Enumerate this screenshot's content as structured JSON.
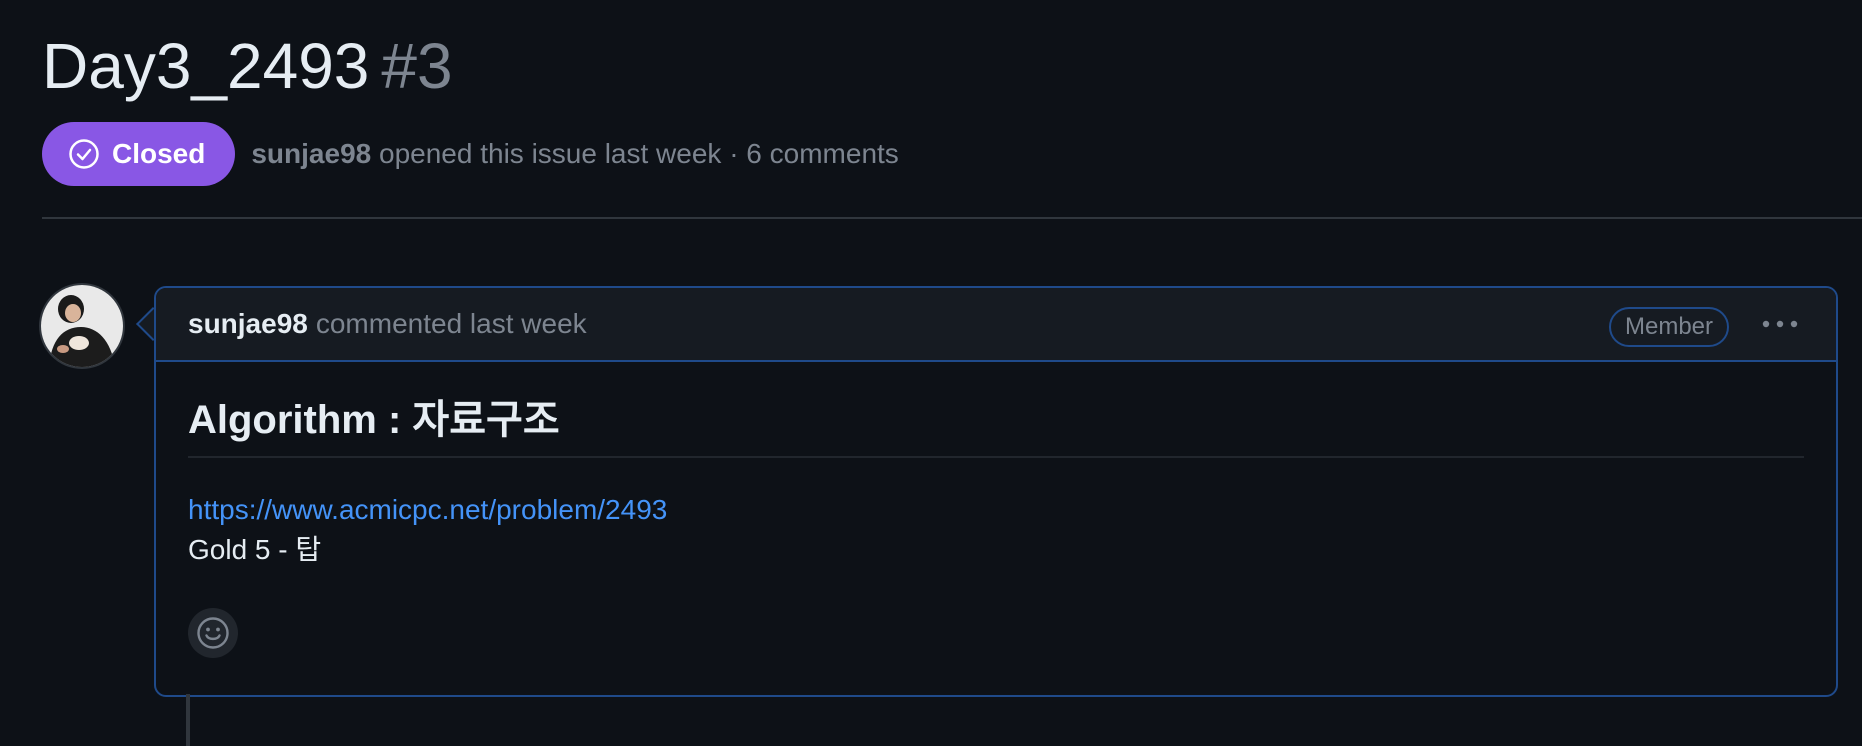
{
  "issue": {
    "title": "Day3_2493",
    "number": "#3",
    "state": "Closed",
    "author": "sunjae98",
    "meta": "opened this issue last week · 6 comments"
  },
  "comment": {
    "author": "sunjae98",
    "meta": "commented last week",
    "role": "Member",
    "heading": "Algorithm : 자료구조",
    "link": "https://www.acmicpc.net/problem/2493",
    "text": "Gold 5 - 탑"
  },
  "icons": {
    "state": "check-circle-icon",
    "more": "kebab-horizontal-icon",
    "reaction": "smiley-icon"
  },
  "colors": {
    "background": "#0d1117",
    "closed_badge": "#8957e5",
    "link": "#4493f8",
    "comment_border": "#1f4a8a"
  }
}
